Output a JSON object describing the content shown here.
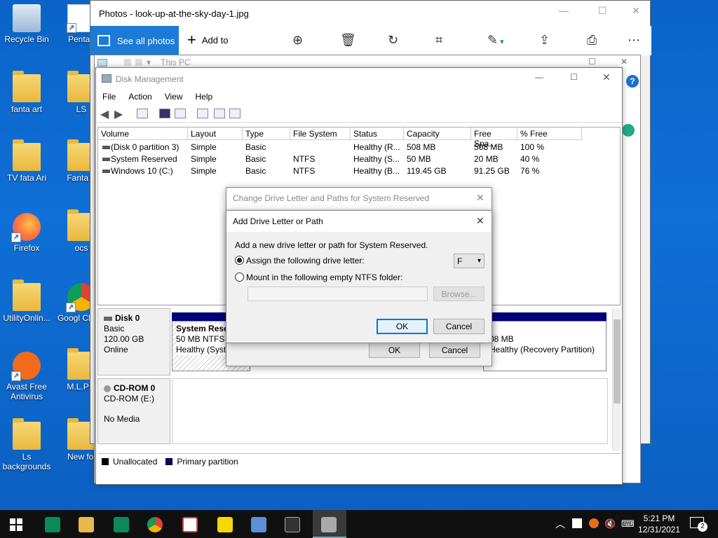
{
  "desktop_icons": [
    {
      "label": "Recycle Bin",
      "icon": "recycle-bin-icon"
    },
    {
      "label": "Pentab",
      "icon": "pentab-icon"
    },
    {
      "label": "fanta art",
      "icon": "folder-icon"
    },
    {
      "label": "LS",
      "icon": "folder-icon"
    },
    {
      "label": "TV fata Ari",
      "icon": "folder-icon"
    },
    {
      "label": "Fanta A",
      "icon": "folder-icon"
    },
    {
      "label": "Firefox",
      "icon": "firefox-icon"
    },
    {
      "label": "ocs",
      "icon": "folder-icon"
    },
    {
      "label": "UtilityOnlin...",
      "icon": "folder-icon"
    },
    {
      "label": "Googl Chron",
      "icon": "chrome-icon"
    },
    {
      "label": "Avast Free Antivirus",
      "icon": "avast-icon"
    },
    {
      "label": "M.L.P b",
      "icon": "folder-icon"
    },
    {
      "label": "Ls backgrounds",
      "icon": "folder-icon"
    },
    {
      "label": "New fol",
      "icon": "folder-icon"
    }
  ],
  "photos": {
    "title": "Photos - look-up-at-the-sky-day-1.jpg",
    "see_all": "See all photos",
    "add_to": "Add to"
  },
  "thispc": {
    "title": "This PC"
  },
  "disk_mgmt": {
    "title": "Disk Management",
    "menu": [
      "File",
      "Action",
      "View",
      "Help"
    ],
    "columns": [
      "Volume",
      "Layout",
      "Type",
      "File System",
      "Status",
      "Capacity",
      "Free Spa...",
      "% Free"
    ],
    "rows": [
      [
        "(Disk 0 partition 3)",
        "Simple",
        "Basic",
        "",
        "Healthy (R...",
        "508 MB",
        "508 MB",
        "100 %"
      ],
      [
        "System Reserved",
        "Simple",
        "Basic",
        "NTFS",
        "Healthy (S...",
        "50 MB",
        "20 MB",
        "40 %"
      ],
      [
        "Windows 10 (C:)",
        "Simple",
        "Basic",
        "NTFS",
        "Healthy (B...",
        "119.45 GB",
        "91.25 GB",
        "76 %"
      ]
    ],
    "disk0": {
      "name": "Disk 0",
      "type": "Basic",
      "size": "120.00 GB",
      "state": "Online"
    },
    "cdrom": {
      "name": "CD-ROM 0",
      "type": "CD-ROM (E:)",
      "media": "No Media"
    },
    "part_sysres": {
      "name": "System Reser",
      "size": "50 MB NTFS",
      "status": "Healthy (Syste"
    },
    "part_recovery": {
      "size": "08 MB",
      "status": "Healthy (Recovery Partition)"
    },
    "legend": {
      "unalloc": "Unallocated",
      "primary": "Primary partition"
    }
  },
  "change_dlg": {
    "title": "Change Drive Letter and Paths for System Reserved",
    "ok": "OK",
    "cancel": "Cancel"
  },
  "add_dlg": {
    "title": "Add Drive Letter or Path",
    "intro": "Add a new drive letter or path for System Reserved.",
    "assign_label": "Assign the following drive letter:",
    "drive_letter": "F",
    "mount_label": "Mount in the following empty NTFS folder:",
    "folder_value": "",
    "browse": "Browse...",
    "ok": "OK",
    "cancel": "Cancel"
  },
  "taskbar": {
    "time": "5:21 PM",
    "date": "12/31/2021",
    "notification_count": "2"
  }
}
